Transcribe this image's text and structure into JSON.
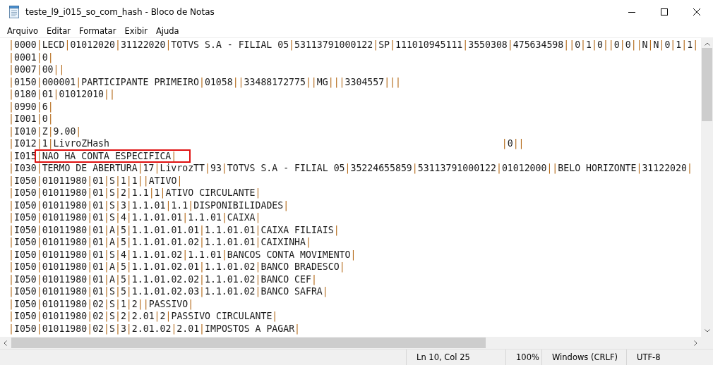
{
  "window": {
    "title": "teste_l9_i015_so_com_hash - Bloco de Notas"
  },
  "menu": [
    "Arquivo",
    "Editar",
    "Formatar",
    "Exibir",
    "Ajuda"
  ],
  "lines": [
    {
      "text": "|0000|LECD|01012020|31122020|TOTVS S.A - FILIAL 05|53113791000122|SP|111010945111|3550308|475634598||0|1|0||0|0||N|N|0|1|1|"
    },
    {
      "text": "|0001|0|"
    },
    {
      "text": "|0007|00||"
    },
    {
      "text": "|0150|000001|PARTICIPANTE PRIMEIRO|01058||33488172775||MG|||3304557|||"
    },
    {
      "text": "|0180|01|01012010||"
    },
    {
      "text": "|0990|6|"
    },
    {
      "text": "|I001|0|"
    },
    {
      "text": "|I010|Z|9.00|"
    },
    {
      "text": "|I012|1|LivroZHash",
      "tail": "|0||"
    },
    {
      "text": "|I015",
      "marked": "|NAO HA CONTA ESPECIFICA|"
    },
    {
      "text": "|I030|TERMO DE ABERTURA|17|LivrozTT|93|TOTVS S.A - FILIAL 05|35224655859|53113791000122|01012000||BELO HORIZONTE|31122020|"
    },
    {
      "text": "|I050|01011980|01|S|1|1||ATIVO|"
    },
    {
      "text": "|I050|01011980|01|S|2|1.1|1|ATIVO CIRCULANTE|"
    },
    {
      "text": "|I050|01011980|01|S|3|1.1.01|1.1|DISPONIBILIDADES|"
    },
    {
      "text": "|I050|01011980|01|S|4|1.1.01.01|1.1.01|CAIXA|"
    },
    {
      "text": "|I050|01011980|01|A|5|1.1.01.01.01|1.1.01.01|CAIXA FILIAIS|"
    },
    {
      "text": "|I050|01011980|01|A|5|1.1.01.01.02|1.1.01.01|CAIXINHA|"
    },
    {
      "text": "|I050|01011980|01|S|4|1.1.01.02|1.1.01|BANCOS CONTA MOVIMENTO|"
    },
    {
      "text": "|I050|01011980|01|A|5|1.1.01.02.01|1.1.01.02|BANCO BRADESCO|"
    },
    {
      "text": "|I050|01011980|01|A|5|1.1.01.02.02|1.1.01.02|BANCO CEF|"
    },
    {
      "text": "|I050|01011980|01|S|5|1.1.01.02.03|1.1.01.02|BANCO SAFRA|"
    },
    {
      "text": "|I050|01011980|02|S|1|2||PASSIVO|"
    },
    {
      "text": "|I050|01011980|02|S|2|2.01|2|PASSIVO CIRCULANTE|"
    },
    {
      "text": "|I050|01011980|02|S|3|2.01.02|2.01|IMPOSTOS A PAGAR|"
    }
  ],
  "status_bar": [
    "Ln 10, Col 25",
    "100%",
    "Windows (CRLF)",
    "UTF-8"
  ]
}
